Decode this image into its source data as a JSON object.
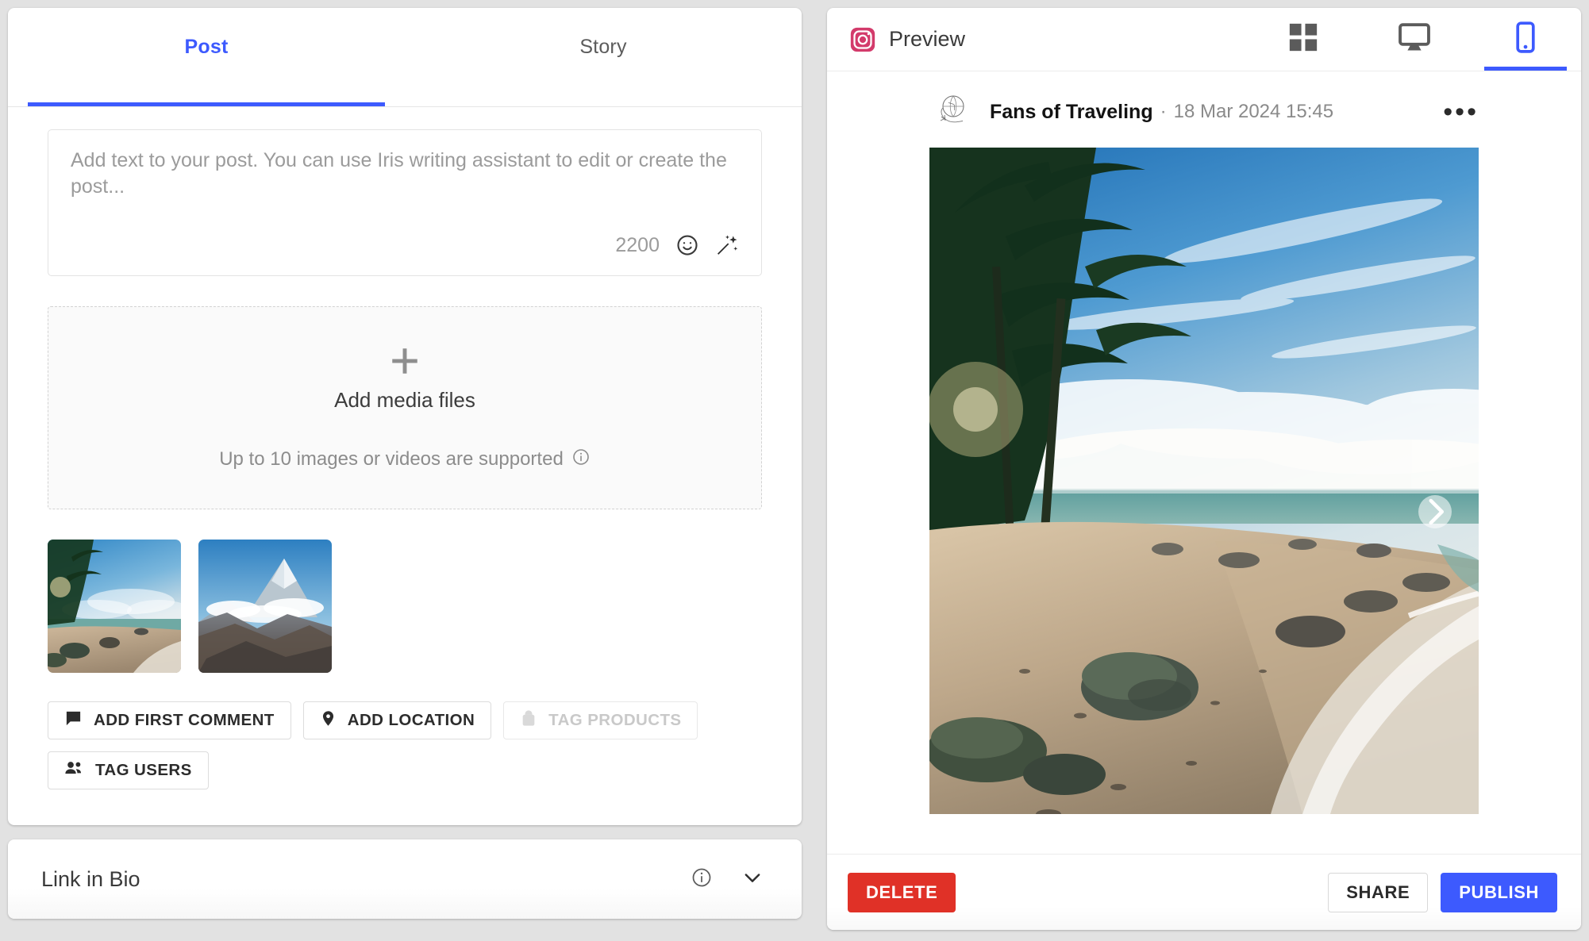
{
  "theme": {
    "accent_blue": "#3d5afe",
    "danger_red": "#e03127",
    "instagram_pink": "#d33b6b",
    "page_background": "#e2e2e2"
  },
  "composer": {
    "tabs": [
      {
        "label": "Post",
        "active": true
      },
      {
        "label": "Story",
        "active": false
      }
    ],
    "text_input": {
      "value": "",
      "placeholder": "Add text to your post. You can use Iris writing assistant to edit or create the post...",
      "char_count": "2200",
      "emoji_icon": "smiley-face-icon",
      "ai_icon": "magic-wand-sparkle-icon"
    },
    "dropzone": {
      "plus_icon": "plus-icon",
      "title": "Add media files",
      "hint": "Up to 10 images or videos are supported",
      "info_icon": "info-circle-icon"
    },
    "thumbnails": [
      {
        "name": "beach-palm-trees-thumbnail"
      },
      {
        "name": "snow-mountain-peak-thumbnail"
      }
    ],
    "actions": [
      {
        "label": "ADD FIRST COMMENT",
        "icon": "comment-bubble-icon",
        "disabled": false
      },
      {
        "label": "ADD LOCATION",
        "icon": "map-pin-icon",
        "disabled": false
      },
      {
        "label": "TAG PRODUCTS",
        "icon": "shopping-bag-icon",
        "disabled": true
      },
      {
        "label": "TAG USERS",
        "icon": "people-icon",
        "disabled": false
      }
    ]
  },
  "link_in_bio": {
    "title": "Link in Bio",
    "info_icon": "info-circle-icon",
    "chevron_icon": "chevron-down-icon"
  },
  "preview": {
    "network_icon": "instagram-icon",
    "label": "Preview",
    "view_modes": [
      {
        "name": "grid-view",
        "icon": "grid-icon",
        "active": false
      },
      {
        "name": "desktop-view",
        "icon": "monitor-icon",
        "active": false
      },
      {
        "name": "mobile-view",
        "icon": "phone-icon",
        "active": true
      }
    ],
    "post": {
      "avatar_icon": "globe-travel-avatar",
      "account_name": "Fans of Traveling",
      "separator": "·",
      "timestamp": "18 Mar 2024 15:45",
      "more_icon": "more-horizontal-icon",
      "media_name": "beach-palm-trees-preview",
      "carousel_next_icon": "chevron-right-icon"
    },
    "footer_buttons": {
      "delete": "DELETE",
      "share": "SHARE",
      "publish": "PUBLISH"
    }
  }
}
